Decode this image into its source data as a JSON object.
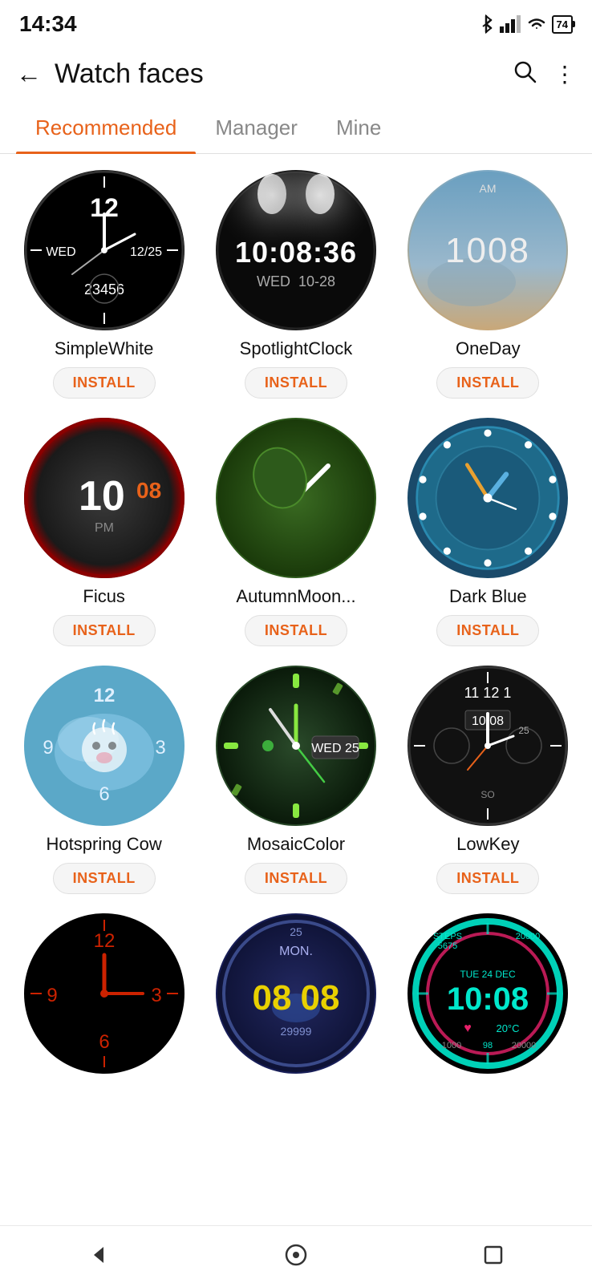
{
  "statusBar": {
    "time": "14:34",
    "battery": "74"
  },
  "header": {
    "backLabel": "←",
    "title": "Watch faces",
    "searchLabel": "🔍",
    "moreLabel": "⋮"
  },
  "tabs": [
    {
      "id": "recommended",
      "label": "Recommended",
      "active": true
    },
    {
      "id": "manager",
      "label": "Manager",
      "active": false
    },
    {
      "id": "mine",
      "label": "Mine",
      "active": false
    }
  ],
  "watchFaces": [
    {
      "id": "simplewhite",
      "name": "SimpleWhite",
      "installLabel": "INSTALL"
    },
    {
      "id": "spotlightclock",
      "name": "SpotlightClock",
      "installLabel": "INSTALL"
    },
    {
      "id": "oneday",
      "name": "OneDay",
      "installLabel": "INSTALL"
    },
    {
      "id": "ficus",
      "name": "Ficus",
      "installLabel": "INSTALL"
    },
    {
      "id": "autumnmoon",
      "name": "AutumnMoon...",
      "installLabel": "INSTALL"
    },
    {
      "id": "darkblue",
      "name": "Dark Blue",
      "installLabel": "INSTALL"
    },
    {
      "id": "hotspring",
      "name": "Hotspring Cow",
      "installLabel": "INSTALL"
    },
    {
      "id": "mosaiccolor",
      "name": "MosaicColor",
      "installLabel": "INSTALL"
    },
    {
      "id": "lowkey",
      "name": "LowKey",
      "installLabel": "INSTALL"
    },
    {
      "id": "red",
      "name": "",
      "installLabel": ""
    },
    {
      "id": "08",
      "name": "",
      "installLabel": ""
    },
    {
      "id": "neon",
      "name": "",
      "installLabel": ""
    }
  ],
  "navBar": {
    "back": "◄",
    "home": "⬤",
    "square": "■"
  }
}
